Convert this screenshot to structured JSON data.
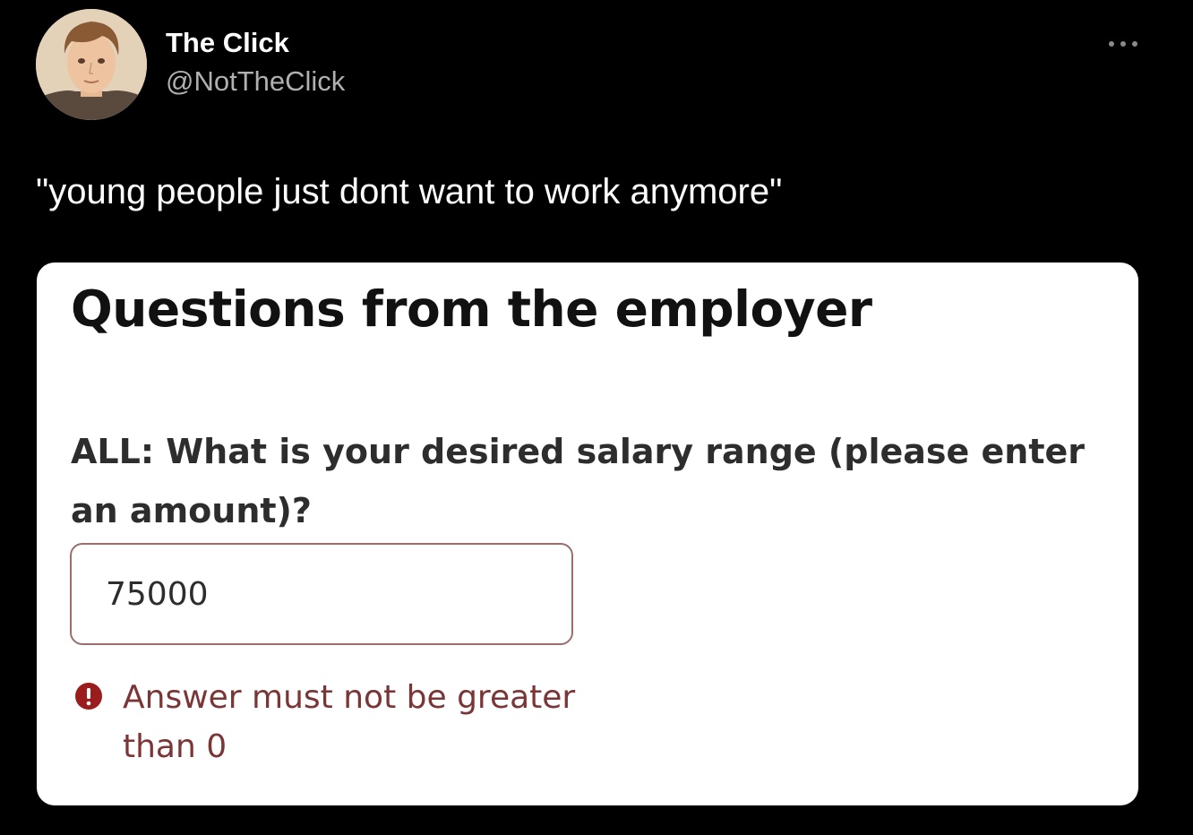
{
  "tweet": {
    "author": {
      "display_name": "The Click",
      "handle": "@NotTheClick",
      "avatar_icon": "avatar-portrait"
    },
    "more_icon": "more-horizontal-icon",
    "text": "\"young people just dont want to work anymore\""
  },
  "form": {
    "heading": "Questions from the employer",
    "question": "ALL: What is your desired salary range (please enter an amount)?",
    "answer_value": "75000",
    "error_icon": "error-circle-icon",
    "error_message": "Answer must not be greater than 0"
  },
  "colors": {
    "background": "#000000",
    "handle": "#b0b0b0",
    "error": "#9b1c1c",
    "error_text": "#7a3636",
    "input_border": "#9a6e6e"
  }
}
